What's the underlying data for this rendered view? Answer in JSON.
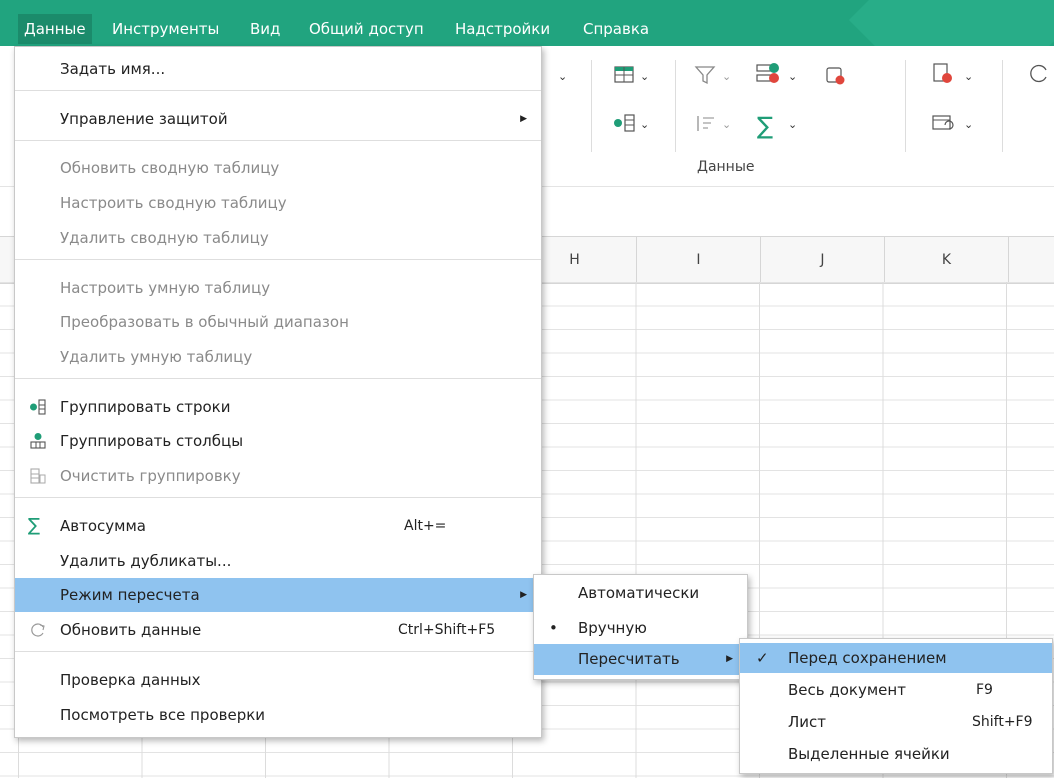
{
  "menubar": {
    "items": [
      "Данные",
      "Инструменты",
      "Вид",
      "Общий доступ",
      "Надстройки",
      "Справка"
    ],
    "active": "Данные"
  },
  "ribbon": {
    "group_label": "Данные"
  },
  "grid": {
    "columns": [
      "H",
      "I",
      "J",
      "K"
    ]
  },
  "data_menu": {
    "items": {
      "set_name": "Задать имя...",
      "protection": "Управление защитой",
      "refresh_pivot": "Обновить сводную таблицу",
      "configure_pivot": "Настроить сводную таблицу",
      "delete_pivot": "Удалить сводную таблицу",
      "configure_smart": "Настроить умную таблицу",
      "convert_range": "Преобразовать в обычный диапазон",
      "delete_smart": "Удалить умную таблицу",
      "group_rows": "Группировать строки",
      "group_cols": "Группировать столбцы",
      "clear_group": "Очистить группировку",
      "autosum": "Автосумма",
      "autosum_shortcut": "Alt+=",
      "remove_duplicates": "Удалить дубликаты...",
      "recalc_mode": "Режим пересчета",
      "refresh_data": "Обновить данные",
      "refresh_shortcut": "Ctrl+Shift+F5",
      "validation": "Проверка данных",
      "view_validations": "Посмотреть все проверки"
    }
  },
  "recalc_menu": {
    "automatic": "Автоматически",
    "manual": "Вручную",
    "recalculate": "Пересчитать",
    "bullet": "•"
  },
  "recalculate_menu": {
    "before_save": "Перед сохранением",
    "check": "✓",
    "whole_document": "Весь документ",
    "whole_document_shortcut": "F9",
    "sheet": "Лист",
    "sheet_shortcut": "Shift+F9",
    "selected_cells": "Выделенные ячейки"
  },
  "colors": {
    "brand": "#21a47f",
    "highlight": "#8fc3ef"
  }
}
